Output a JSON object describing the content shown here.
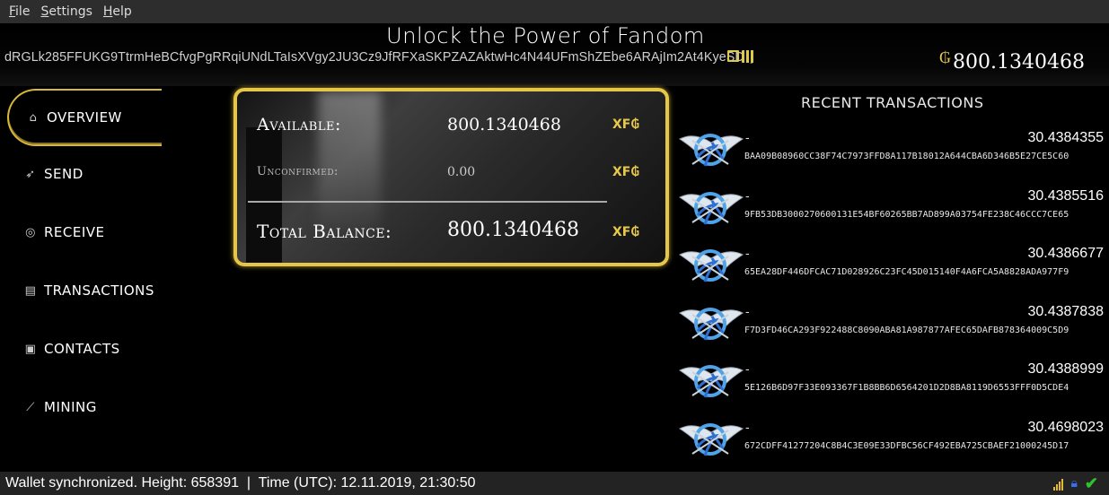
{
  "menu": {
    "file": "File",
    "settings": "Settings",
    "help": "Help"
  },
  "header": {
    "title": "Unlock the Power of Fandom",
    "address": "dRGLk285FFUKG9TtrmHeBCfvgPgRRqiUNdLTaIsXVgy2JU3Cz9JfRFXaSKPZAZAktwHc4N44UFmShZEbe6ARAjIm2At4KyeSDQ",
    "currency_symbol": "₲",
    "balance": "800.1340468"
  },
  "sidebar": {
    "items": [
      {
        "label": "OVERVIEW",
        "icon": "home-icon",
        "glyph": "⌂"
      },
      {
        "label": "SEND",
        "icon": "send-icon",
        "glyph": "➶"
      },
      {
        "label": "RECEIVE",
        "icon": "receive-icon",
        "glyph": "◎"
      },
      {
        "label": "TRANSACTIONS",
        "icon": "transactions-icon",
        "glyph": "▤"
      },
      {
        "label": "CONTACTS",
        "icon": "contacts-icon",
        "glyph": "▣"
      },
      {
        "label": "MINING",
        "icon": "mining-icon",
        "glyph": "⟋"
      }
    ]
  },
  "overview": {
    "available_label": "Available:",
    "available_value": "800.1340468",
    "unconfirmed_label": "Unconfirmed:",
    "unconfirmed_value": "0.00",
    "total_label": "Total Balance:",
    "total_value": "800.1340468",
    "ticker": "XF₲"
  },
  "recent": {
    "title": "RECENT TRANSACTIONS",
    "items": [
      {
        "label": "-",
        "amount": "30.4384355",
        "hash": "BAA09B08960CC38F74C7973FFD8A117B18012A644CBA6D346B5E27CE5C60"
      },
      {
        "label": "-",
        "amount": "30.4385516",
        "hash": "9FB53DB3000270600131E54BF60265BB7AD899A03754FE238C46CCC7CE65"
      },
      {
        "label": "-",
        "amount": "30.4386677",
        "hash": "65EA28DF446DFCAC71D028926C23FC45D015140F4A6FCA5A8828ADA977F9"
      },
      {
        "label": "-",
        "amount": "30.4387838",
        "hash": "F7D3FD46CA293F922488C8090ABA81A987877AFEC65DAFB878364009C5D9"
      },
      {
        "label": "-",
        "amount": "30.4388999",
        "hash": "5E126B6D97F33E093367F1B8BB6D6564201D2D8BA8119D6553FFF0D5CDE4"
      },
      {
        "label": "-",
        "amount": "30.4698023",
        "hash": "672CDFF41277204C8B4C3E09E33DFBC56CF492EBA725CBAEF21000245D17"
      }
    ]
  },
  "status": {
    "text": "Wallet synchronized. Height: 658391  |  Time (UTC): 12.11.2019, 21:30:50"
  },
  "colors": {
    "accent": "#e6c64a",
    "lock": "#3b6cf0",
    "check": "#2fc22f"
  }
}
